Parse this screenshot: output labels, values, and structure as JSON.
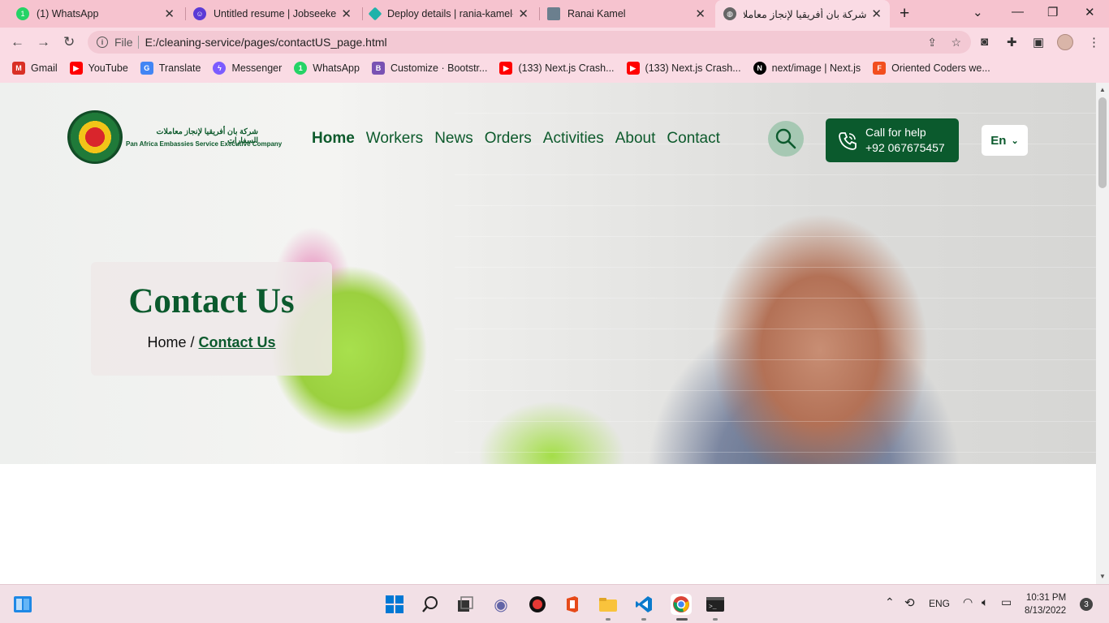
{
  "browser": {
    "tabs": [
      {
        "title": "(1) WhatsApp",
        "icon": "whatsapp-icon"
      },
      {
        "title": "Untitled resume | Jobseeker",
        "icon": "jobseeker-icon"
      },
      {
        "title": "Deploy details | rania-kamel-",
        "icon": "netlify-icon"
      },
      {
        "title": "Ranai Kamel",
        "icon": "page-icon"
      },
      {
        "title": "شركة بان أفريقيا لإنجاز معاملات",
        "icon": "globe-icon"
      }
    ],
    "address": {
      "scheme_label": "File",
      "url": "E:/cleaning-service/pages/contactUS_page.html"
    },
    "bookmarks": [
      {
        "label": "Gmail",
        "icon": "gmail-icon",
        "color": "#d93025"
      },
      {
        "label": "YouTube",
        "icon": "youtube-icon",
        "color": "#ff0000"
      },
      {
        "label": "Translate",
        "icon": "translate-icon",
        "color": "#4285f4"
      },
      {
        "label": "Messenger",
        "icon": "messenger-icon",
        "color": "#7b5cff"
      },
      {
        "label": "WhatsApp",
        "icon": "whatsapp-icon",
        "color": "#25d366"
      },
      {
        "label": "Customize · Bootstr...",
        "icon": "bootstrap-icon",
        "color": "#7952b3"
      },
      {
        "label": "(133) Next.js Crash...",
        "icon": "youtube-icon",
        "color": "#ff0000"
      },
      {
        "label": "(133) Next.js Crash...",
        "icon": "youtube-icon",
        "color": "#ff0000"
      },
      {
        "label": "next/image | Next.js",
        "icon": "nextjs-icon",
        "color": "#000000"
      },
      {
        "label": "Oriented Coders we...",
        "icon": "figma-icon",
        "color": "#f24e1e"
      }
    ]
  },
  "site": {
    "logo_ar": "شركة بان أفريقيا لإنجاز معاملات السفارات",
    "logo_en": "Pan Africa Embassies Service Executive Company",
    "nav": [
      "Home",
      "Workers",
      "News",
      "Orders",
      "Activities",
      "About",
      "Contact"
    ],
    "call": {
      "line1": "Call for help",
      "line2": "+92 067675457"
    },
    "lang": "En",
    "hero_title": "Contact Us",
    "breadcrumb": {
      "home": "Home",
      "sep": "/",
      "current": "Contact Us"
    },
    "colors": {
      "brand_green": "#0b5a2d"
    }
  },
  "taskbar": {
    "lang": "ENG",
    "time": "10:31 PM",
    "date": "8/13/2022",
    "notifications": "3"
  }
}
